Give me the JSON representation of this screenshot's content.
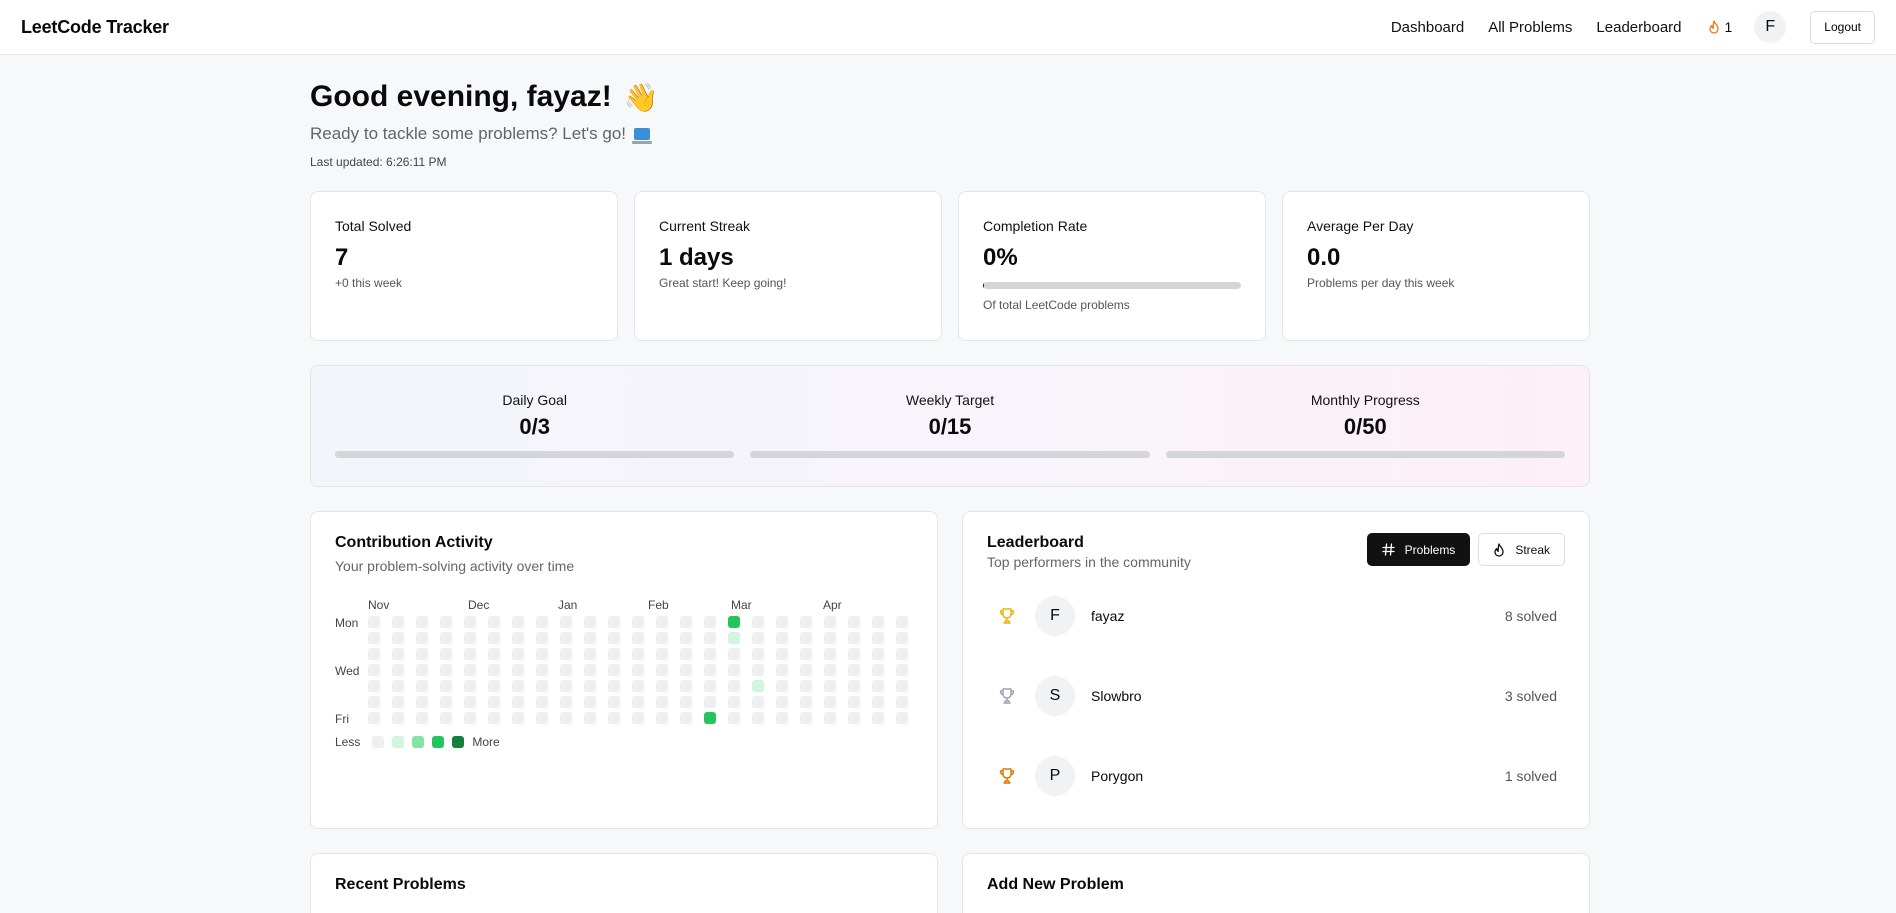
{
  "app": {
    "title": "LeetCode Tracker"
  },
  "nav": {
    "links": [
      "Dashboard",
      "All Problems",
      "Leaderboard"
    ],
    "streak_count": "1",
    "avatar_initial": "F",
    "logout_label": "Logout"
  },
  "header": {
    "greeting": "Good evening, fayaz!",
    "greeting_emoji": "👋",
    "subtitle": "Ready to tackle some problems? Let's go!",
    "last_updated": "Last updated: 6:26:11 PM"
  },
  "stats": [
    {
      "label": "Total Solved",
      "value": "7",
      "sub": "+0 this week"
    },
    {
      "label": "Current Streak",
      "value": "1 days",
      "sub": "Great start! Keep going!"
    },
    {
      "label": "Completion Rate",
      "value": "0%",
      "sub": "Of total LeetCode problems",
      "progress": 0.3
    },
    {
      "label": "Average Per Day",
      "value": "0.0",
      "sub": "Problems per day this week"
    }
  ],
  "goals": [
    {
      "label": "Daily Goal",
      "value": "0/3",
      "progress": 0
    },
    {
      "label": "Weekly Target",
      "value": "0/15",
      "progress": 0
    },
    {
      "label": "Monthly Progress",
      "value": "0/50",
      "progress": 0
    }
  ],
  "contribution": {
    "title": "Contribution Activity",
    "description": "Your problem-solving activity over time",
    "months": [
      "Nov",
      "Dec",
      "Jan",
      "Feb",
      "Mar",
      "Apr"
    ],
    "weekdays": [
      "Mon",
      "Wed",
      "Fri"
    ],
    "legend_less": "Less",
    "legend_more": "More",
    "weeks": 23,
    "active_cells": [
      {
        "week": 15,
        "day": 0,
        "level": 3
      },
      {
        "week": 15,
        "day": 1,
        "level": 1
      },
      {
        "week": 16,
        "day": 4,
        "level": 1
      },
      {
        "week": 14,
        "day": 6,
        "level": 3
      }
    ]
  },
  "leaderboard": {
    "title": "Leaderboard",
    "description": "Top performers in the community",
    "toggle_problems": "Problems",
    "toggle_streak": "Streak",
    "entries": [
      {
        "initial": "F",
        "name": "fayaz",
        "solved": "8 solved",
        "trophy_color": "#eab308"
      },
      {
        "initial": "S",
        "name": "Slowbro",
        "solved": "3 solved",
        "trophy_color": "#9ca3af"
      },
      {
        "initial": "P",
        "name": "Porygon",
        "solved": "1 solved",
        "trophy_color": "#d97706"
      }
    ]
  },
  "bottom": {
    "recent_title": "Recent Problems",
    "add_title": "Add New Problem"
  }
}
